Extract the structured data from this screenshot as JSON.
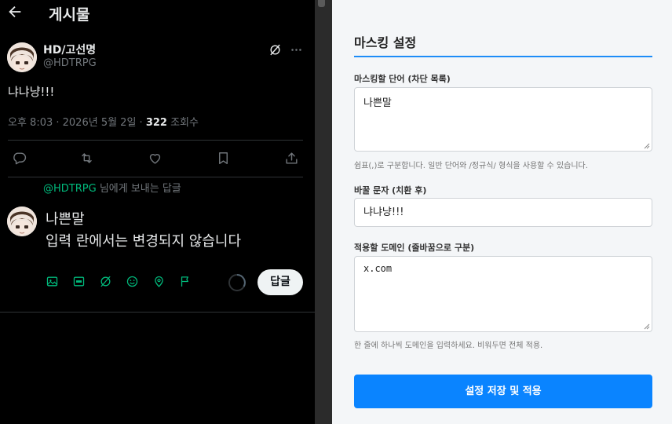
{
  "header": {
    "title": "게시물",
    "back_icon": "arrow-left-icon"
  },
  "post": {
    "author_name": "HD/고선명",
    "author_handle": "@HDTRPG",
    "text": "냐냐냥!!!",
    "time": "오후 8:03 · 2026년 5월 2일 · ",
    "view_count": "322",
    "view_label": " 조회수",
    "top_icons": [
      "grok-icon",
      "more-icon"
    ],
    "actions": [
      "reply-icon",
      "repost-icon",
      "like-icon",
      "bookmark-icon",
      "share-icon"
    ]
  },
  "compose": {
    "reply_to_handle": "@HDTRPG",
    "reply_to_suffix": " 님에게 보내는 답글",
    "line1": "나쁜말",
    "line2": "입력 란에서는 변경되지 않습니다",
    "tools": [
      "image-icon",
      "gif-icon",
      "grok-icon",
      "emoji-icon",
      "location-icon",
      "flag-icon"
    ],
    "reply_label": "답글"
  },
  "settings": {
    "title": "마스킹 설정",
    "words_label": "마스킹할 단어 (차단 목록)",
    "words_value": "나쁜말",
    "words_hint": "쉼표(,)로 구분합니다. 일반 단어와 /정규식/ 형식을 사용할 수 있습니다.",
    "replace_label": "바꿀 문자 (치환 후)",
    "replace_value": "냐냐냥!!!",
    "domains_label": "적용할 도메인 (줄바꿈으로 구분)",
    "domains_value": "x.com",
    "domains_hint": "한 줄에 하나씩 도메인을 입력하세요. 비워두면 전체 적용.",
    "save_label": "설정 저장 및 적용"
  },
  "colors": {
    "accent": "#0a84ff",
    "mention": "#00ba7c",
    "tool_icons": "#00ba7c"
  }
}
